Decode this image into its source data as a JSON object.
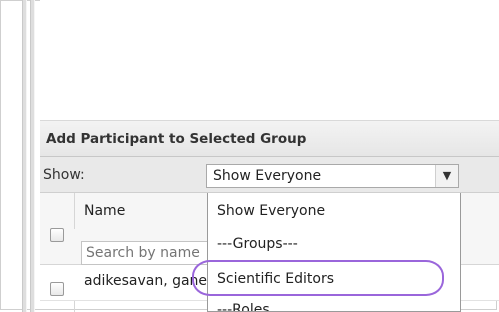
{
  "panel": {
    "title": "Add Participant to Selected Group"
  },
  "filter": {
    "show_label": "Show:",
    "selected_value": "Show Everyone",
    "arrow_icon": "chevron-down-icon",
    "options": [
      "Show Everyone",
      "---Groups---",
      "Scientific Editors",
      "---Roles..."
    ]
  },
  "grid": {
    "columns": [
      "",
      "Name"
    ],
    "search_placeholder": "Search by name",
    "rows": [
      {
        "name": "adikesavan, ganesh"
      }
    ]
  },
  "colors": {
    "highlight_ring": "#9a66db",
    "header_bg": "#e6e6e6",
    "border": "#a9a9a9"
  }
}
